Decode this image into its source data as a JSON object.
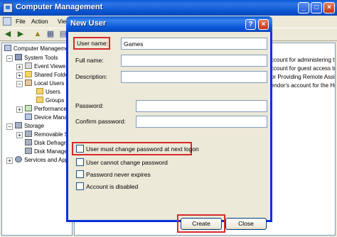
{
  "window": {
    "title": "Computer Management",
    "menu": [
      "File",
      "Action",
      "View"
    ],
    "controls": {
      "minimize": "_",
      "maximize": "□",
      "close": "×"
    }
  },
  "toolbar_icons": [
    "back-arrow-icon",
    "forward-arrow-icon",
    "up-folder-icon",
    "show-hide-tree-icon",
    "export-list-icon"
  ],
  "tree": {
    "items": [
      {
        "label": "Computer Management",
        "icon": "computer-icon"
      },
      {
        "label": "System Tools",
        "icon": "tools-icon"
      },
      {
        "label": "Event Viewer",
        "icon": "event-viewer-icon"
      },
      {
        "label": "Shared Folders",
        "icon": "shared-folder-icon"
      },
      {
        "label": "Local Users and Groups",
        "icon": "users-icon"
      },
      {
        "label": "Users",
        "icon": "folder-icon"
      },
      {
        "label": "Groups",
        "icon": "folder-icon"
      },
      {
        "label": "Performance Logs and Alerts",
        "icon": "performance-icon"
      },
      {
        "label": "Device Manager",
        "icon": "device-icon"
      },
      {
        "label": "Storage",
        "icon": "storage-icon"
      },
      {
        "label": "Removable Storage",
        "icon": "disk-icon"
      },
      {
        "label": "Disk Defragmenter",
        "icon": "disk-icon"
      },
      {
        "label": "Disk Management",
        "icon": "disk-icon"
      },
      {
        "label": "Services and Applications",
        "icon": "gear-icon"
      }
    ]
  },
  "list": {
    "descriptions": [
      "ccount for administering th",
      "ccount for guest access to",
      "or Providing Remote Assis",
      "endor's account for the Hel"
    ]
  },
  "dialog": {
    "title": "New User",
    "help_glyph": "?",
    "close_glyph": "×",
    "fields": {
      "username_label": "User name:",
      "username_value": "Games",
      "fullname_label": "Full name:",
      "fullname_value": "",
      "description_label": "Description:",
      "description_value": "",
      "password_label": "Password:",
      "password_value": "",
      "confirm_label": "Confirm password:",
      "confirm_value": ""
    },
    "checkboxes": [
      {
        "label": "User must change password at next logon",
        "checked": false
      },
      {
        "label": "User cannot change password",
        "checked": false
      },
      {
        "label": "Password never expires",
        "checked": false
      },
      {
        "label": "Account is disabled",
        "checked": false
      }
    ],
    "buttons": {
      "create": "Create",
      "close": "Close"
    },
    "highlight_color": "#d42a2a"
  }
}
